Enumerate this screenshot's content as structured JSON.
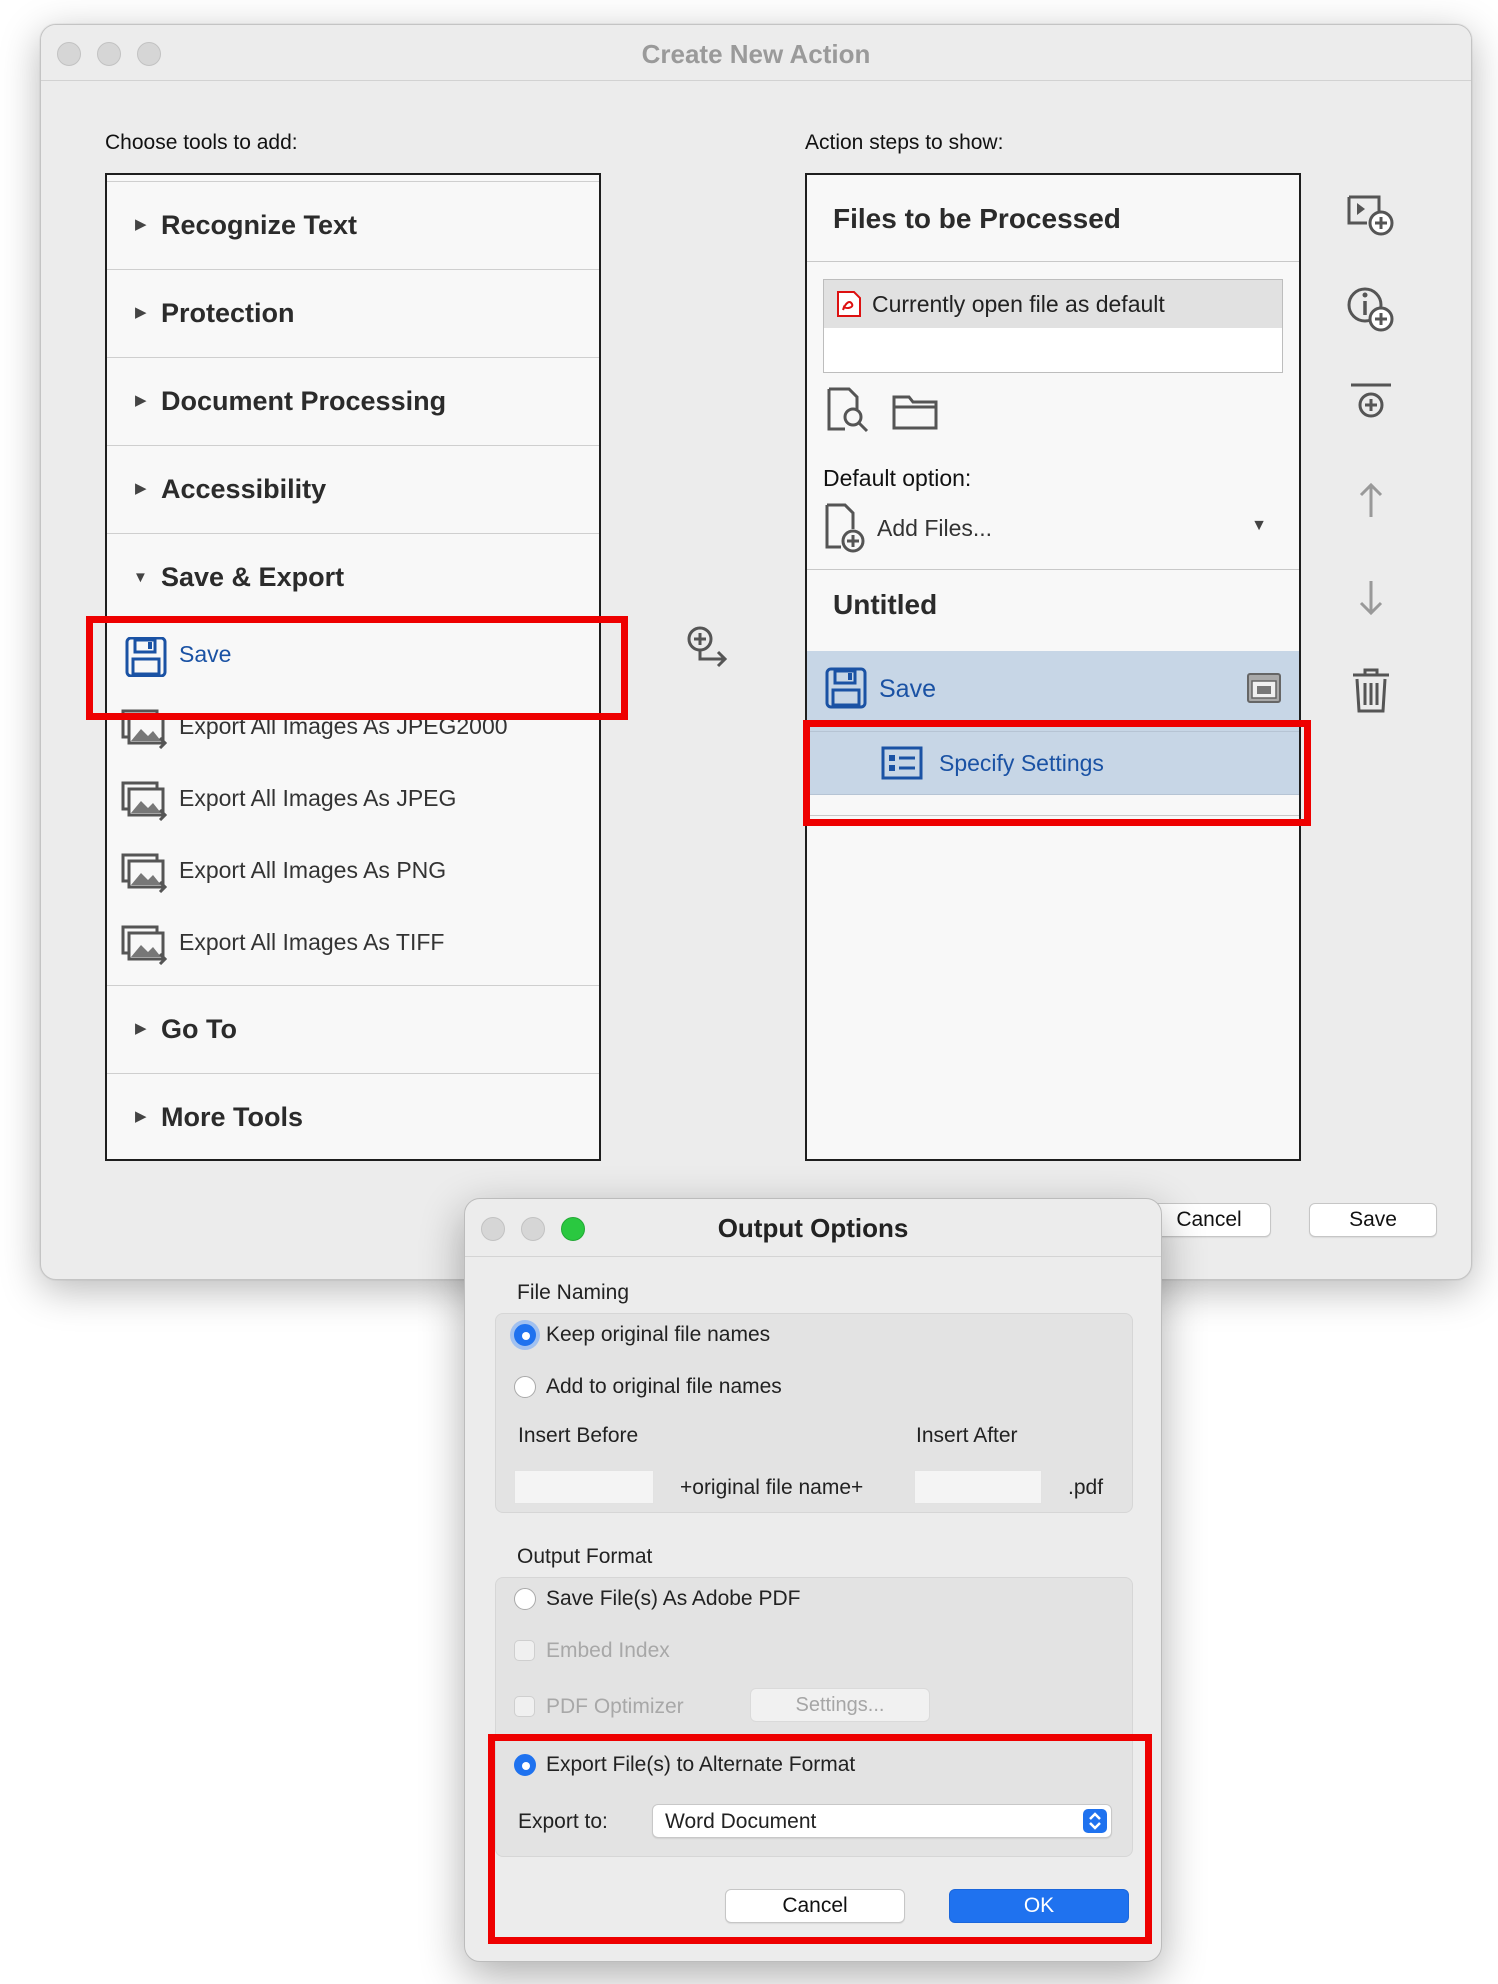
{
  "main_window": {
    "title": "Create New Action",
    "left_label": "Choose tools to add:",
    "right_label": "Action steps to show:",
    "categories": [
      {
        "label": "Recognize Text",
        "expanded": false
      },
      {
        "label": "Protection",
        "expanded": false
      },
      {
        "label": "Document Processing",
        "expanded": false
      },
      {
        "label": "Accessibility",
        "expanded": false
      },
      {
        "label": "Save & Export",
        "expanded": true
      },
      {
        "label": "Go To",
        "expanded": false
      },
      {
        "label": "More Tools",
        "expanded": false
      }
    ],
    "save_export_items": [
      {
        "label": "Save",
        "icon": "save-icon",
        "selected": true
      },
      {
        "label": "Export All Images As JPEG2000",
        "icon": "export-images-icon"
      },
      {
        "label": "Export All Images As JPEG",
        "icon": "export-images-icon"
      },
      {
        "label": "Export All Images As PNG",
        "icon": "export-images-icon"
      },
      {
        "label": "Export All Images As TIFF",
        "icon": "export-images-icon"
      }
    ],
    "files_section": {
      "header": "Files to be Processed",
      "current_file": "Currently open file as default",
      "default_option_label": "Default option:",
      "default_option_value": "Add Files..."
    },
    "steps": {
      "group_title": "Untitled",
      "step_label": "Save",
      "sub_step_label": "Specify Settings"
    },
    "buttons": {
      "cancel": "Cancel",
      "save": "Save"
    }
  },
  "dialog": {
    "title": "Output Options",
    "file_naming_label": "File Naming",
    "keep_names": "Keep original file names",
    "add_names": "Add to original file names",
    "insert_before": "Insert Before",
    "insert_after": "Insert After",
    "original_file_name": "+original file name+",
    "extension": ".pdf",
    "output_format_label": "Output Format",
    "save_as_pdf": "Save File(s) As Adobe PDF",
    "embed_index": "Embed Index",
    "pdf_optimizer": "PDF Optimizer",
    "settings_button": "Settings...",
    "export_alternate": "Export File(s) to Alternate Format",
    "export_to_label": "Export to:",
    "export_to_value": "Word Document",
    "cancel": "Cancel",
    "ok": "OK"
  },
  "colors": {
    "accent_blue": "#1f72ef",
    "selected_step_bg": "#c7d6e6",
    "link_blue": "#1a52a4",
    "highlight_red": "#ee0000"
  }
}
